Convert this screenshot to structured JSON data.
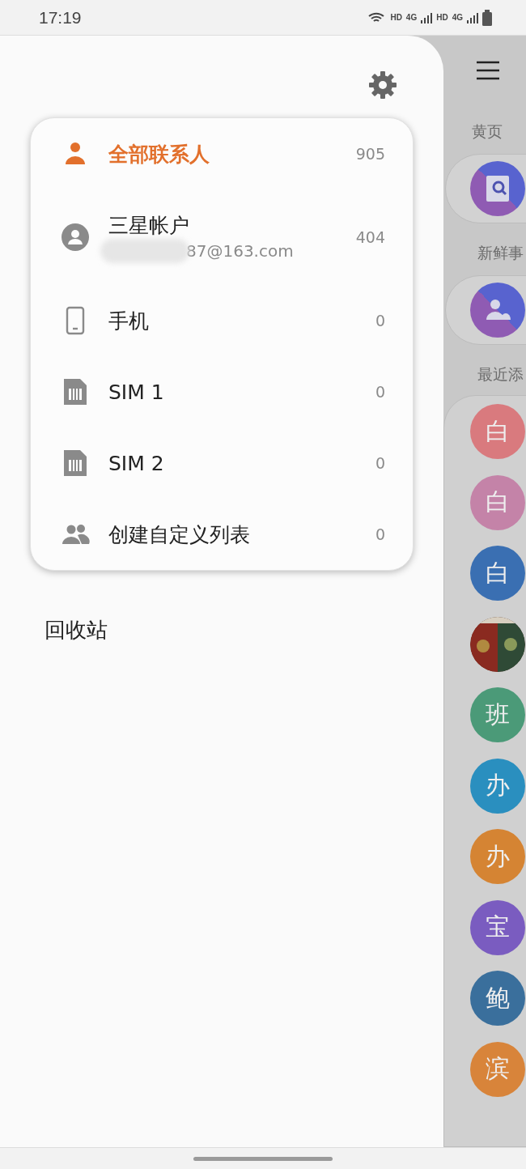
{
  "status_bar": {
    "time": "17:19",
    "indicators": [
      "HD",
      "4G",
      "HD",
      "4G"
    ]
  },
  "drawer": {
    "items": [
      {
        "kind": "all",
        "label": "全部联系人",
        "count": "905",
        "selected": true
      },
      {
        "kind": "account",
        "label": "三星帐户",
        "sublabel": "87@163.com",
        "count": "404",
        "selected": false
      },
      {
        "kind": "phone",
        "label": "手机",
        "count": "0",
        "selected": false
      },
      {
        "kind": "sim",
        "label": "SIM 1",
        "count": "0",
        "selected": false
      },
      {
        "kind": "sim",
        "label": "SIM 2",
        "count": "0",
        "selected": false
      },
      {
        "kind": "group",
        "label": "创建自定义列表",
        "count": "0",
        "selected": false
      }
    ],
    "trash": "回收站"
  },
  "background": {
    "sections": [
      {
        "title": "黄页",
        "kind": "yellow_pages"
      },
      {
        "title": "新鲜事",
        "kind": "news"
      },
      {
        "title": "最近添",
        "kind": "recent"
      }
    ],
    "contacts": [
      {
        "kind": "initial",
        "initial": "白",
        "color": "#d97a7e"
      },
      {
        "kind": "initial",
        "initial": "白",
        "color": "#c483a8"
      },
      {
        "kind": "initial",
        "initial": "白",
        "color": "#3a6fb2"
      },
      {
        "kind": "picture"
      },
      {
        "kind": "initial",
        "initial": "班",
        "color": "#4b9a78"
      },
      {
        "kind": "initial",
        "initial": "办",
        "color": "#2a8fbf"
      },
      {
        "kind": "initial",
        "initial": "办",
        "color": "#d58433"
      },
      {
        "kind": "initial",
        "initial": "宝",
        "color": "#7a5cc0"
      },
      {
        "kind": "initial",
        "initial": "鲍",
        "color": "#3a6f9c"
      },
      {
        "kind": "initial",
        "initial": "滨",
        "color": "#d8843a"
      }
    ]
  }
}
